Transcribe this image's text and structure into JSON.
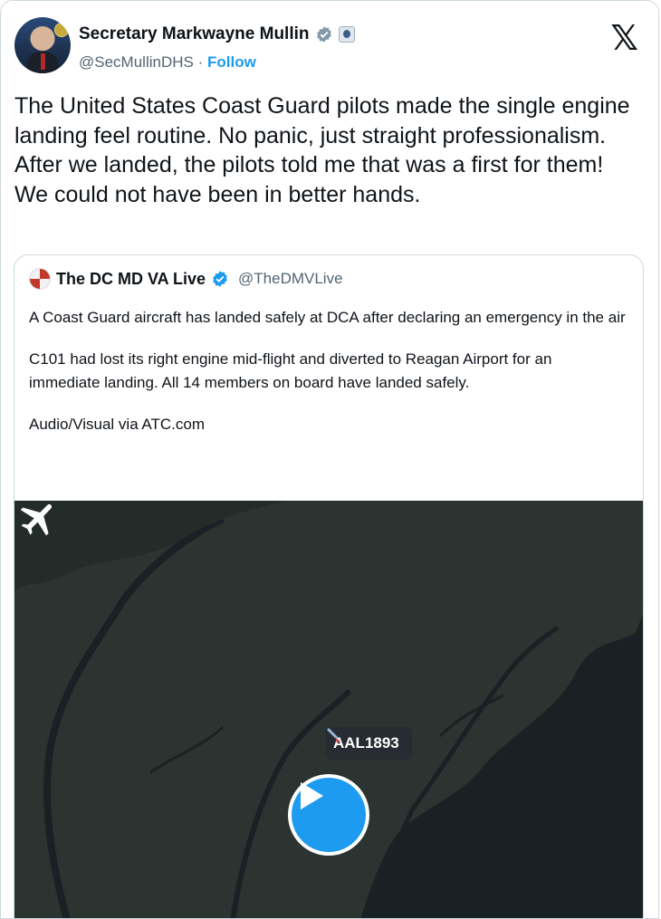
{
  "author": {
    "name": "Secretary Markwayne Mullin",
    "handle": "@SecMullinDHS",
    "separator": "·",
    "follow_label": "Follow"
  },
  "icons": {
    "verified": "verified-badge-icon",
    "affiliation": "dhs-seal-icon",
    "platform": "x-logo-icon",
    "play": "play-icon"
  },
  "tweet": {
    "text": "The United States Coast Guard pilots made the single engine landing feel routine. No panic, just straight professionalism. After we landed, the pilots told me that was a first for them! We could not have been in better hands."
  },
  "quoted": {
    "name": "The DC MD VA Live",
    "handle": "@TheDMVLive",
    "paragraphs": [
      "A Coast Guard aircraft has landed safely at DCA after declaring an emergency in the air",
      "C101 had lost its right engine mid-flight and diverted to Reagan Airport for an immediate landing. All 14 members on board have landed safely.",
      "Audio/Visual via ATC.com"
    ],
    "media": {
      "flight_label": "AAL1893"
    }
  },
  "colors": {
    "accent": "#1d9bf0",
    "verified_author": "#829aab",
    "verified_quote": "#1d9bf0",
    "map_land": "#2b3430",
    "map_water": "#1a2124"
  }
}
